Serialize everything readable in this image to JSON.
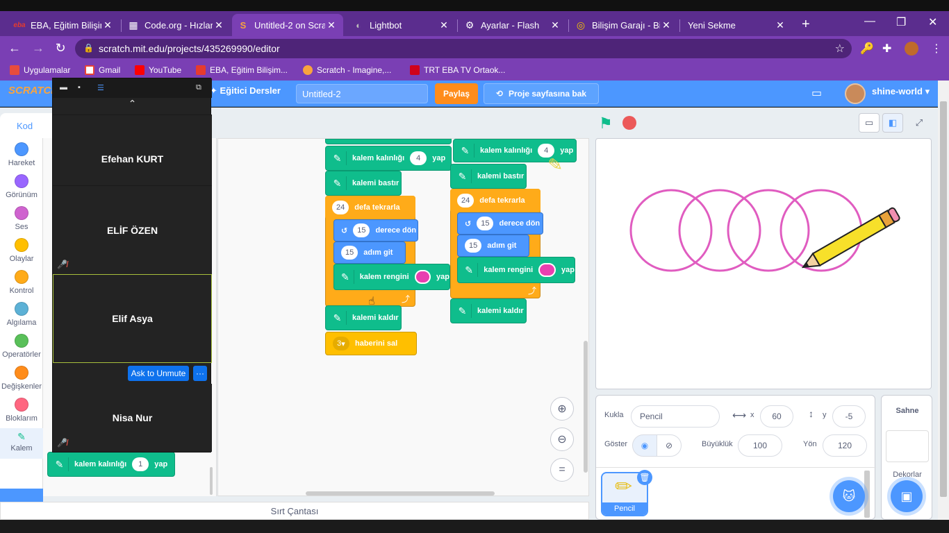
{
  "browser": {
    "tabs": [
      {
        "title": "EBA, Eğitim Bilişim",
        "icon": "eba-icon",
        "fav_text": "eba",
        "fav_color": "#e63b2e"
      },
      {
        "title": "Code.org - Hızland",
        "icon": "codeorg-icon",
        "fav_text": "▦",
        "fav_color": "#ffffff"
      },
      {
        "title": "Untitled-2 on Scra",
        "icon": "scratch-icon",
        "fav_text": "S",
        "fav_color": "#f9a43e"
      },
      {
        "title": "Lightbot",
        "icon": "globe-icon",
        "fav_text": "◐",
        "fav_color": "#bbbbbb"
      },
      {
        "title": "Ayarlar - Flash",
        "icon": "gear-icon",
        "fav_text": "⚙",
        "fav_color": "#ffffff"
      },
      {
        "title": "Bilişim Garajı - Bilg",
        "icon": "garaj-icon",
        "fav_text": "◎",
        "fav_color": "#f5c400"
      },
      {
        "title": "Yeni Sekme",
        "icon": "",
        "fav_text": "",
        "fav_color": ""
      }
    ],
    "url": "scratch.mit.edu/projects/435269990/editor",
    "bookmarks": [
      {
        "label": "Uygulamalar",
        "color": "#e74c3c"
      },
      {
        "label": "Gmail",
        "color": "#ea4335"
      },
      {
        "label": "YouTube",
        "color": "#ff0000"
      },
      {
        "label": "EBA, Eğitim Bilişim...",
        "color": "#e63b2e"
      },
      {
        "label": "Scratch - Imagine,...",
        "color": "#f9a43e"
      },
      {
        "label": "TRT EBA TV Ortaok...",
        "color": "#d0021b"
      }
    ]
  },
  "scratch": {
    "logo": "SCRATCH",
    "tutorials": "Eğitici Dersler",
    "project_title": "Untitled-2",
    "share": "Paylaş",
    "see_project": "Proje sayfasına bak",
    "username": "shine-world",
    "code_tab": "Kod",
    "categories": [
      {
        "label": "Hareket",
        "color": "#4c97ff"
      },
      {
        "label": "Görünüm",
        "color": "#9966ff"
      },
      {
        "label": "Ses",
        "color": "#cf63cf"
      },
      {
        "label": "Olaylar",
        "color": "#ffbf00"
      },
      {
        "label": "Kontrol",
        "color": "#ffab19"
      },
      {
        "label": "Algılama",
        "color": "#5cb1d6"
      },
      {
        "label": "Operatörler",
        "color": "#59c059"
      },
      {
        "label": "Değişkenler",
        "color": "#ff8c1a"
      },
      {
        "label": "Bloklarım",
        "color": "#ff6680"
      },
      {
        "label": "Kalem",
        "color": "#0fbd8c"
      }
    ],
    "palette_block": {
      "text": "kalem kalınlığı",
      "value": "1",
      "suffix": "yap"
    },
    "blocks": {
      "thickness": "kalem kalınlığı",
      "yap": "yap",
      "pen_down": "kalemi bastır",
      "repeat": "defa tekrarla",
      "turn": "derece dön",
      "move": "adım git",
      "pen_color": "kalem rengini",
      "pen_up": "kalemi kaldır",
      "broadcast": "haberini sal"
    },
    "values": {
      "thickness_left": "4",
      "thickness_right": "4",
      "repeat_left": "24",
      "repeat_right": "24",
      "turn_left": "15",
      "turn_right": "15",
      "move_left": "15",
      "move_right": "15",
      "broadcast": "3"
    },
    "backpack": "Sırt Çantası",
    "sprite": {
      "label_sprite": "Kukla",
      "name": "Pencil",
      "label_x": "x",
      "x": "60",
      "label_y": "y",
      "y": "-5",
      "label_show": "Göster",
      "label_size": "Büyüklük",
      "size": "100",
      "label_direction": "Yön",
      "direction": "120"
    },
    "stage_panel": {
      "title": "Sahne",
      "backdrops": "Dekorlar"
    },
    "pen_color": "#e83fb0"
  },
  "zoom": {
    "participants": [
      {
        "name": "Efehan KURT",
        "muted": false
      },
      {
        "name": "ELİF ÖZEN",
        "muted": true
      },
      {
        "name": "Elif Asya",
        "muted": false
      },
      {
        "name": "Nisa Nur",
        "muted": true
      }
    ],
    "ask_to_unmute": "Ask to Unmute",
    "more": "···"
  }
}
